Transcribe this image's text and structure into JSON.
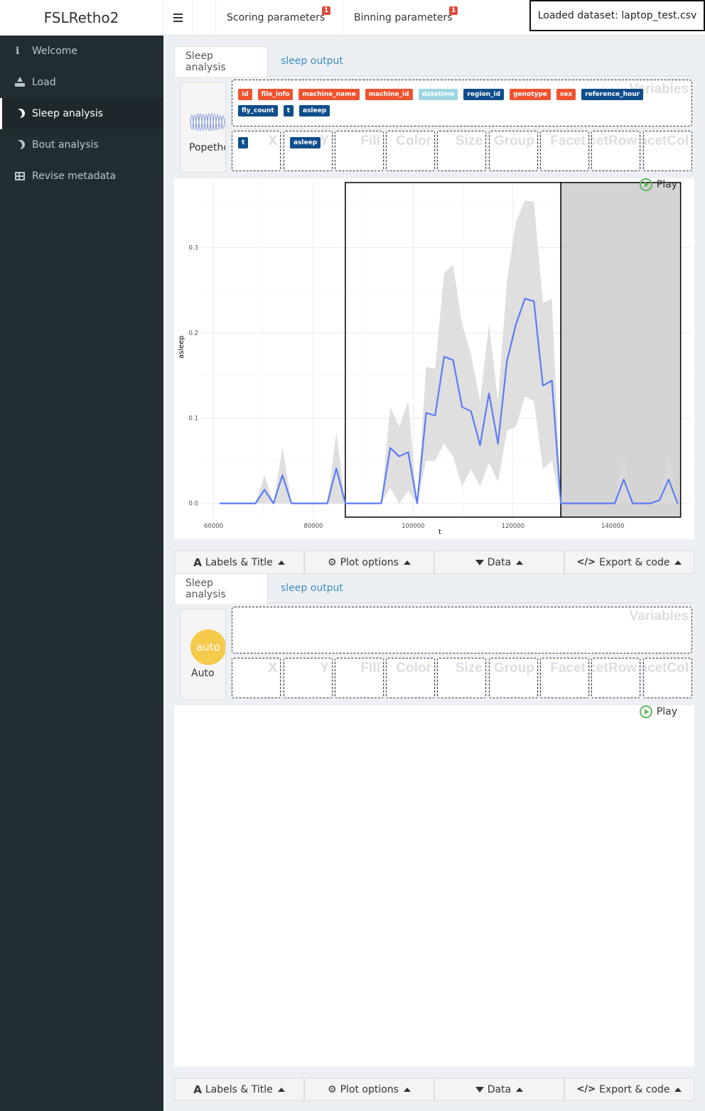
{
  "app": {
    "title": "FSLRetho2"
  },
  "topbar": {
    "tabs": [
      {
        "label": "Scoring parameters",
        "badge": "1"
      },
      {
        "label": "Binning parameters",
        "badge": "1"
      }
    ],
    "dataset": "Loaded dataset: laptop_test.csv"
  },
  "sidebar": {
    "items": [
      {
        "label": "Welcome",
        "icon": "info-icon"
      },
      {
        "label": "Load",
        "icon": "upload-icon"
      },
      {
        "label": "Sleep analysis",
        "icon": "moon-icon",
        "active": true
      },
      {
        "label": "Bout analysis",
        "icon": "moon-icon"
      },
      {
        "label": "Revise metadata",
        "icon": "table-icon"
      }
    ]
  },
  "panels": [
    {
      "tabs": [
        "Sleep analysis",
        "sleep output"
      ],
      "geom_label": "Popetho",
      "variables_title": "Variables",
      "variables": [
        {
          "name": "id",
          "kind": "factor"
        },
        {
          "name": "file_info",
          "kind": "factor"
        },
        {
          "name": "machine_name",
          "kind": "factor"
        },
        {
          "name": "machine_id",
          "kind": "factor"
        },
        {
          "name": "datetime",
          "kind": "date"
        },
        {
          "name": "region_id",
          "kind": "num"
        },
        {
          "name": "genotype",
          "kind": "factor"
        },
        {
          "name": "sex",
          "kind": "factor"
        },
        {
          "name": "reference_hour",
          "kind": "num"
        },
        {
          "name": "fly_count",
          "kind": "num"
        },
        {
          "name": "t",
          "kind": "num"
        },
        {
          "name": "asleep",
          "kind": "num"
        }
      ],
      "drops": [
        {
          "label": "X",
          "value": "t"
        },
        {
          "label": "Y",
          "value": "asleep"
        },
        {
          "label": "Fill"
        },
        {
          "label": "Color"
        },
        {
          "label": "Size"
        },
        {
          "label": "Group"
        },
        {
          "label": "Facet"
        },
        {
          "label": "FacetRow"
        },
        {
          "label": "FacetCol"
        }
      ],
      "play_label": "Play"
    },
    {
      "tabs": [
        "Sleep analysis",
        "sleep output"
      ],
      "geom_label": "Auto",
      "geom_circle": "auto",
      "variables_title": "Variables",
      "variables": [],
      "drops": [
        {
          "label": "X"
        },
        {
          "label": "Y"
        },
        {
          "label": "Fill"
        },
        {
          "label": "Color"
        },
        {
          "label": "Size"
        },
        {
          "label": "Group"
        },
        {
          "label": "Facet"
        },
        {
          "label": "FacetRow"
        },
        {
          "label": "FacetCol"
        }
      ],
      "play_label": "Play"
    }
  ],
  "toolbar": {
    "labels_title": "Labels & Title",
    "plot_options": "Plot options",
    "data": "Data",
    "export_code": "Export & code"
  },
  "chart_data": {
    "type": "line",
    "xlabel": "t",
    "ylabel": "asleep",
    "xlim": [
      57500,
      155500
    ],
    "ylim": [
      -0.017,
      0.377
    ],
    "x_ticks": [
      60000,
      80000,
      100000,
      120000,
      140000
    ],
    "y_ticks": [
      0.0,
      0.1,
      0.2,
      0.3
    ],
    "line_color": "#5b7cf5",
    "ribbon_color": "#d9d9d9",
    "shaded_regions": [
      {
        "x0": 86400,
        "x1": 129600,
        "fill": "#ffffff"
      },
      {
        "x0": 129600,
        "x1": 153600,
        "fill": "#cccccc"
      }
    ],
    "series": [
      {
        "x": [
          61200,
          63000,
          64800,
          66600,
          68400,
          70200,
          72000,
          73800,
          75600,
          77400,
          79200,
          81000,
          82800,
          84600,
          86400,
          88200,
          90000,
          91800,
          93600,
          95400,
          97200,
          99000,
          100800,
          102600,
          104400,
          106200,
          108000,
          109800,
          111600,
          113400,
          115200,
          117000,
          118800,
          120600,
          122400,
          124200,
          126000,
          127800,
          129600,
          131400,
          133200,
          135000,
          136800,
          138600,
          140400,
          142200,
          144000,
          145800,
          147600,
          149400,
          151200,
          153000
        ],
        "y": [
          0,
          0,
          0,
          0,
          0,
          0.016,
          0,
          0.033,
          0,
          0,
          0,
          0,
          0,
          0.041,
          0,
          0,
          0,
          0,
          0,
          0.065,
          0.055,
          0.06,
          0,
          0.106,
          0.103,
          0.172,
          0.168,
          0.113,
          0.108,
          0.068,
          0.129,
          0.07,
          0.167,
          0.21,
          0.24,
          0.237,
          0.138,
          0.144,
          0,
          0,
          0,
          0,
          0,
          0,
          0,
          0.028,
          0,
          0,
          0,
          0.004,
          0.028,
          0
        ],
        "lower": [
          0,
          0,
          0,
          0,
          0,
          0,
          0,
          0,
          0,
          0,
          0,
          0,
          0,
          0,
          0,
          0,
          0,
          0,
          0,
          0.018,
          0,
          0.015,
          0,
          0.05,
          0.05,
          0.07,
          0.055,
          0.02,
          0.04,
          0.02,
          0.048,
          0.025,
          0.085,
          0.09,
          0.125,
          0.12,
          0.04,
          0.05,
          0,
          0,
          0,
          0,
          0,
          0,
          0,
          0,
          0,
          0,
          0,
          0,
          0,
          0
        ],
        "upper": [
          0,
          0,
          0,
          0,
          0,
          0.033,
          0,
          0.066,
          0,
          0,
          0,
          0,
          0,
          0.084,
          0,
          0,
          0,
          0,
          0,
          0.113,
          0.09,
          0.12,
          0,
          0.16,
          0.158,
          0.27,
          0.28,
          0.21,
          0.175,
          0.12,
          0.21,
          0.12,
          0.26,
          0.33,
          0.355,
          0.354,
          0.235,
          0.24,
          0,
          0,
          0,
          0,
          0,
          0,
          0,
          0.057,
          0,
          0,
          0,
          0.01,
          0.057,
          0
        ]
      }
    ]
  }
}
